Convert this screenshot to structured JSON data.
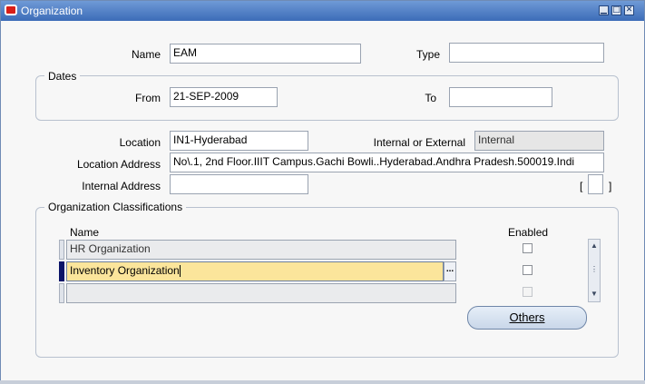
{
  "window": {
    "title": "Organization",
    "controls": [
      "minimize-icon",
      "maximize-icon",
      "close-icon"
    ]
  },
  "header": {
    "name_label": "Name",
    "name_value": "EAM",
    "type_label": "Type",
    "type_value": ""
  },
  "dates": {
    "group_label": "Dates",
    "from_label": "From",
    "from_value": "21-SEP-2009",
    "to_label": "To",
    "to_value": ""
  },
  "location": {
    "location_label": "Location",
    "location_value": "IN1-Hyderabad",
    "int_ext_label": "Internal or External",
    "int_ext_value": "Internal",
    "address_label": "Location Address",
    "address_value": "No\\.1, 2nd Floor.IIIT Campus.Gachi Bowli..Hyderabad.Andhra Pradesh.500019.Indi",
    "internal_address_label": "Internal Address",
    "internal_address_value": "",
    "bracket_open": "[",
    "bracket_close": "]"
  },
  "classifications": {
    "group_label": "Organization Classifications",
    "name_header": "Name",
    "enabled_header": "Enabled",
    "rows": [
      {
        "name": "HR Organization",
        "enabled": false
      },
      {
        "name": "Inventory Organization",
        "enabled": false
      },
      {
        "name": "",
        "enabled": false
      }
    ],
    "lov_glyph": "...",
    "others_button": "Others"
  }
}
